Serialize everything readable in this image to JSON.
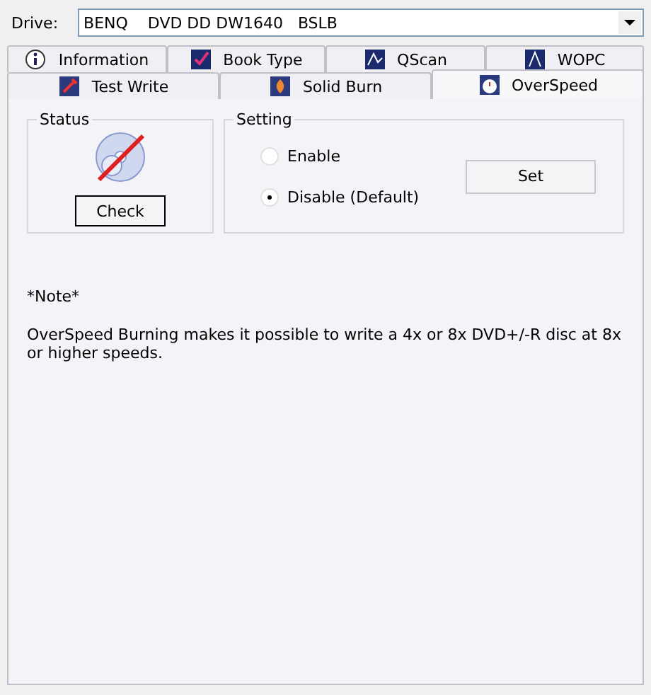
{
  "drive": {
    "label": "Drive:",
    "value": "BENQ    DVD DD DW1640   BSLB"
  },
  "tab_rows": [
    [
      {
        "label": "Information",
        "selected": false
      },
      {
        "label": "Book Type",
        "selected": false
      },
      {
        "label": "QScan",
        "selected": false
      },
      {
        "label": "WOPC",
        "selected": false
      }
    ],
    [
      {
        "label": "Test Write",
        "selected": false
      },
      {
        "label": "Solid Burn",
        "selected": false
      },
      {
        "label": "OverSpeed",
        "selected": true
      }
    ]
  ],
  "status": {
    "title": "Status",
    "button": "Check"
  },
  "setting": {
    "title": "Setting",
    "options": [
      {
        "label": "Enable",
        "selected": false
      },
      {
        "label": "Disable (Default)",
        "selected": true
      }
    ],
    "button": "Set"
  },
  "note": {
    "title": "*Note*",
    "text": "OverSpeed Burning makes it possible to write a 4x or 8x DVD+/-R disc at 8x or higher speeds."
  }
}
